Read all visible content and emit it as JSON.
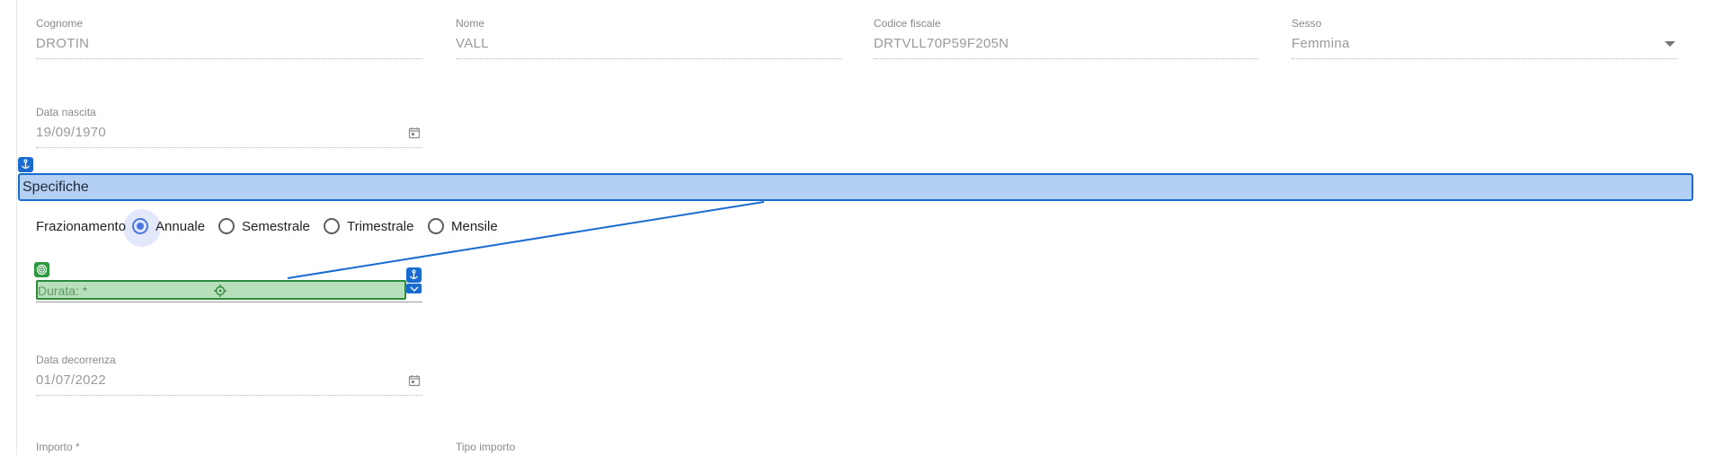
{
  "personal": {
    "cognome": {
      "label": "Cognome",
      "value": "DROTIN"
    },
    "nome": {
      "label": "Nome",
      "value": "VALL"
    },
    "codice_fiscale": {
      "label": "Codice fiscale",
      "value": "DRTVLL70P59F205N"
    },
    "sesso": {
      "label": "Sesso",
      "value": "Femmina"
    },
    "data_nascita": {
      "label": "Data nascita",
      "value": "19/09/1970"
    }
  },
  "section": {
    "title": "Specifiche"
  },
  "frazionamento": {
    "label": "Frazionamento",
    "options": [
      "Annuale",
      "Semestrale",
      "Trimestrale",
      "Mensile"
    ],
    "selected": "Annuale"
  },
  "durata": {
    "placeholder": "Durata: *"
  },
  "data_decorrenza": {
    "label": "Data decorrenza",
    "value": "01/07/2022"
  },
  "importo": {
    "label": "Importo *"
  },
  "tipo_importo": {
    "label": "Tipo importo"
  },
  "colors": {
    "section_bg": "#b3cff2",
    "section_border": "#1a6bd0",
    "selection_green": "#b7dfb9",
    "radio_selected": "#4a78e0"
  }
}
